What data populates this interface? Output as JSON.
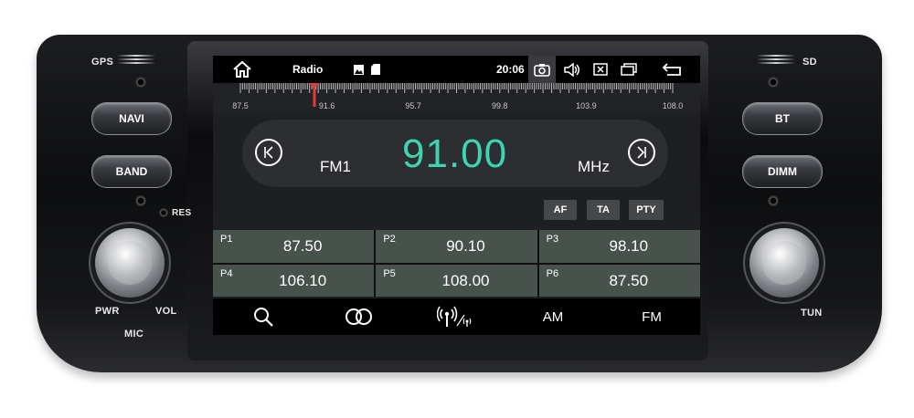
{
  "hardware": {
    "gps_label": "GPS",
    "sd_label": "SD",
    "res_label": "RES",
    "pwr_label": "PWR",
    "vol_label": "VOL",
    "mic_label": "MIC",
    "tun_label": "TUN",
    "left_buttons": [
      "NAVI",
      "BAND"
    ],
    "right_buttons": [
      "BT",
      "DIMM"
    ]
  },
  "statusbar": {
    "title": "Radio",
    "time": "20:06",
    "icons": [
      "home-icon",
      "gallery-icon",
      "sd-card-icon",
      "screenshot-icon",
      "volume-icon",
      "close-window-icon",
      "recent-apps-icon",
      "back-icon"
    ]
  },
  "tuner": {
    "scale_labels": [
      "87.5",
      "91.6",
      "95.7",
      "99.8",
      "103.9",
      "108.0"
    ],
    "current_position_mhz": 91.0,
    "range_mhz": [
      87.5,
      108.0
    ]
  },
  "frequency": {
    "band": "FM1",
    "value": "91.00",
    "unit": "MHz",
    "accent_color": "#3dd4b0"
  },
  "options": [
    "AF",
    "TA",
    "PTY"
  ],
  "presets": [
    {
      "label": "P1",
      "freq": "87.50"
    },
    {
      "label": "P2",
      "freq": "90.10"
    },
    {
      "label": "P3",
      "freq": "98.10"
    },
    {
      "label": "P4",
      "freq": "106.10"
    },
    {
      "label": "P5",
      "freq": "108.00"
    },
    {
      "label": "P6",
      "freq": "87.50"
    }
  ],
  "bottombar": {
    "icons": [
      "search-icon",
      "stereo-icon",
      "signal-icon"
    ],
    "am_label": "AM",
    "fm_label": "FM"
  }
}
